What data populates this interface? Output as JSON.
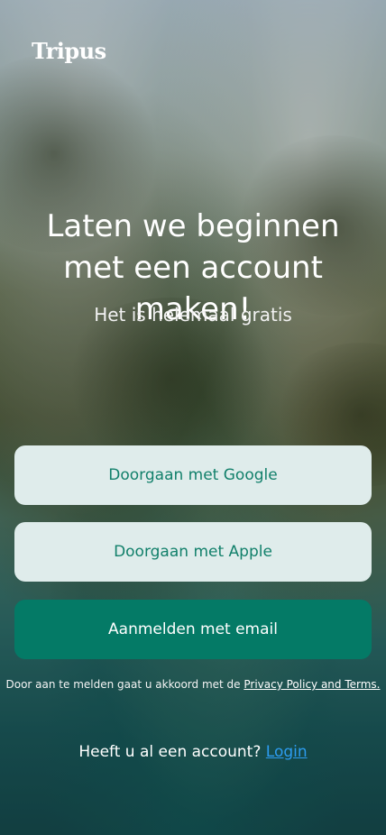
{
  "brand": {
    "logo_text": "Tripus"
  },
  "hero": {
    "headline": "Laten we beginnen met een account maken!",
    "subline": "Het is helemaal gratis"
  },
  "buttons": {
    "google_label": "Doorgaan met Google",
    "apple_label": "Doorgaan met Apple",
    "email_label": "Aanmelden met email"
  },
  "terms": {
    "prefix": "Door aan te melden gaat u akkoord met de ",
    "link_label": "Privacy Policy and Terms."
  },
  "login": {
    "prompt": "Heeft u al een account?",
    "link_label": "Login"
  },
  "colors": {
    "accent": "#047a66",
    "button_light_bg": "#dfeceb",
    "button_light_text": "#12806b",
    "link": "#2d9cf0"
  }
}
